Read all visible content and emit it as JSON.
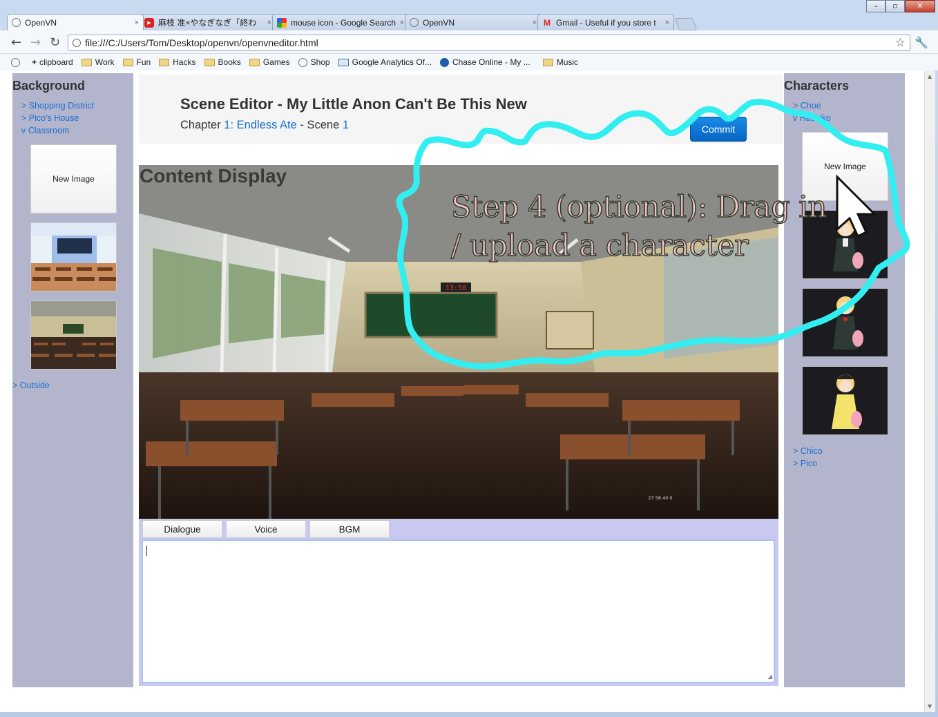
{
  "browser": {
    "tabs": [
      {
        "label": "OpenVN",
        "active": true
      },
      {
        "label": "麻枝 准×やなぎなぎ「終わ",
        "active": false
      },
      {
        "label": "mouse icon - Google Search",
        "active": false
      },
      {
        "label": "OpenVN",
        "active": false
      },
      {
        "label": "Gmail - Useful if you store t",
        "active": false
      }
    ],
    "close_glyph": "×",
    "url": "file:///C:/Users/Tom/Desktop/openvn/openvneditor.html",
    "bookmarks": [
      {
        "label": "clipboard",
        "icon": "plus-icon"
      },
      {
        "label": "Work",
        "icon": "folder-icon"
      },
      {
        "label": "Fun",
        "icon": "folder-icon"
      },
      {
        "label": "Hacks",
        "icon": "folder-icon"
      },
      {
        "label": "Books",
        "icon": "folder-icon"
      },
      {
        "label": "Games",
        "icon": "folder-icon"
      },
      {
        "label": "Shop",
        "icon": "globe-icon"
      },
      {
        "label": "Google Analytics Of...",
        "icon": "analytics-icon"
      },
      {
        "label": "Chase Online - My ...",
        "icon": "chase-icon"
      },
      {
        "label": "Music",
        "icon": "folder-icon"
      }
    ]
  },
  "background_panel": {
    "title": "Background",
    "items": [
      "> Shopping District",
      "> Pico's House",
      "v Classroom"
    ],
    "new_image_label": "New Image",
    "outside_label": "> Outside"
  },
  "header": {
    "title": "Scene Editor - My Little Anon Can't Be This New",
    "chapter_prefix": "Chapter",
    "chapter_link": "1: Endless Ate",
    "scene_sep": "- Scene",
    "scene_link": "1",
    "commit_label": "Commit"
  },
  "content": {
    "label": "Content Display",
    "screen_digits": "13:58",
    "corner_text": "27 58 40 0"
  },
  "editor_tabs": [
    "Dialogue",
    "Voice",
    "BGM"
  ],
  "characters_panel": {
    "title": "Characters",
    "items_top": [
      "> Choe",
      "v Hachiko"
    ],
    "new_image_label": "New Image",
    "items_bottom": [
      "> Chico",
      "> Pico"
    ]
  },
  "annotation": {
    "line1": "Step 4 (optional): Drag in",
    "line2": "/ upload a character",
    "stroke_color": "#33eef0"
  }
}
